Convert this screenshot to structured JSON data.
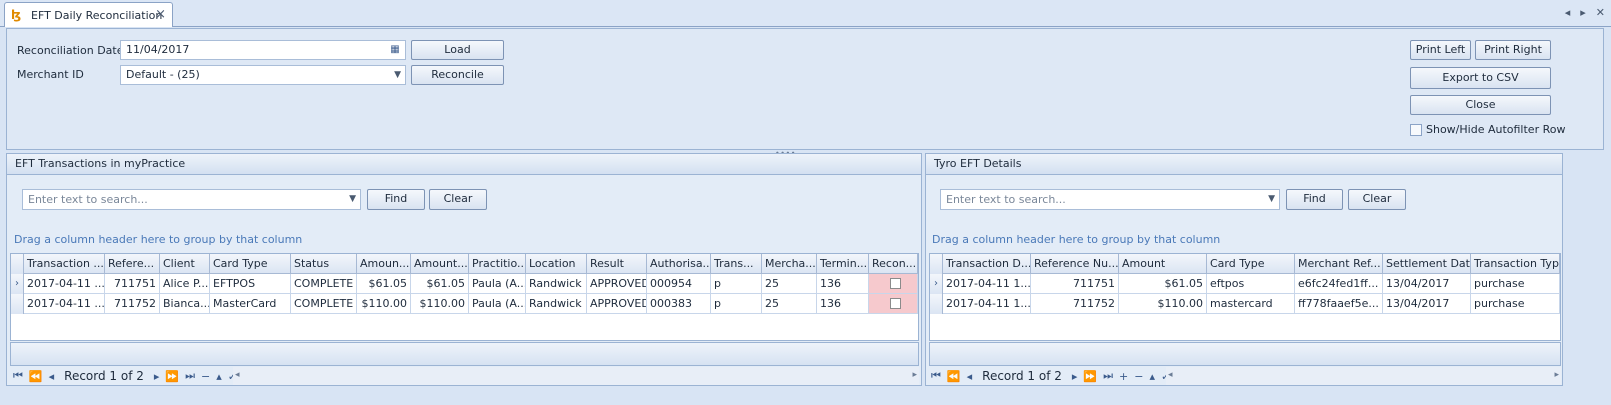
{
  "window": {
    "tab_title": "EFT Daily Reconciliation",
    "tab_icon": "app-logo-icon",
    "close_glyph": "×",
    "nav_prev": "◂",
    "nav_next": "▸",
    "nav_close": "✕"
  },
  "toolbar": {
    "date_label": "Reconciliation Date",
    "date_value": "11/04/2017",
    "merchant_label": "Merchant ID",
    "merchant_value": "Default - (25)",
    "load_label": "Load",
    "reconcile_label": "Reconcile",
    "print_left_label": "Print Left",
    "print_right_label": "Print Right",
    "export_label": "Export to CSV",
    "close_label": "Close",
    "autofilter_label": "Show/Hide Autofilter Row"
  },
  "left_panel": {
    "title": "EFT Transactions in myPractice",
    "search_placeholder": "Enter text to search...",
    "find_label": "Find",
    "clear_label": "Clear",
    "group_hint": "Drag a column header here to group by that column",
    "columns": [
      "Transaction ...",
      "Refere...",
      "Client",
      "Card Type",
      "Status",
      "Amoun...",
      "Amount...",
      "Practitio...",
      "Location",
      "Result",
      "Authorisa...",
      "Trans...",
      "Mercha...",
      "Termin...",
      "Recon..."
    ],
    "rows": [
      [
        "2017-04-11 ...",
        "711751",
        "Alice P...",
        "EFTPOS",
        "COMPLETE",
        "$61.05",
        "$61.05",
        "Paula (A...",
        "Randwick",
        "APPROVED",
        "000954",
        "p",
        "25",
        "136",
        ""
      ],
      [
        "2017-04-11 ...",
        "711752",
        "Bianca...",
        "MasterCard",
        "COMPLETE",
        "$110.00",
        "$110.00",
        "Paula (A...",
        "Randwick",
        "APPROVED",
        "000383",
        "p",
        "25",
        "136",
        ""
      ]
    ],
    "record_text": "Record 1 of 2"
  },
  "right_panel": {
    "title": "Tyro EFT Details",
    "search_placeholder": "Enter text to search...",
    "find_label": "Find",
    "clear_label": "Clear",
    "group_hint": "Drag a column header here to group by that column",
    "columns": [
      "Transaction D...",
      "Reference Nu...",
      "Amount",
      "Card Type",
      "Merchant Ref...",
      "Settlement Date",
      "Transaction Type"
    ],
    "rows": [
      [
        "2017-04-11 1...",
        "711751",
        "$61.05",
        "eftpos",
        "e6fc24fed1ff...",
        "13/04/2017",
        "purchase"
      ],
      [
        "2017-04-11 1...",
        "711752",
        "$110.00",
        "mastercard",
        "ff778faaef5e...",
        "13/04/2017",
        "purchase"
      ]
    ],
    "record_text": "Record 1 of 2"
  },
  "colors": {
    "reconcile_cell": "#f6c9cd",
    "accent": "#4a79b8"
  }
}
